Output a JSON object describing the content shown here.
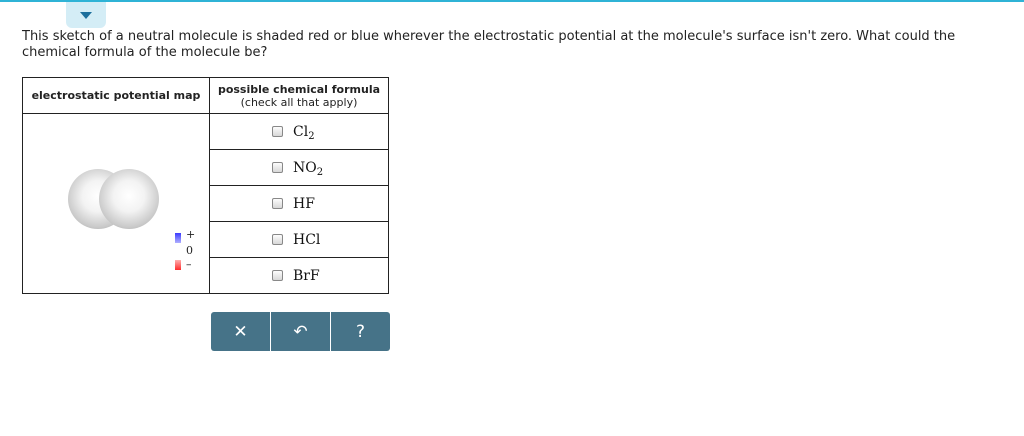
{
  "question": {
    "text": "This sketch of a neutral molecule is shaded red or blue wherever the electrostatic potential at the molecule's surface isn't zero. What could the chemical formula of the molecule be?"
  },
  "table": {
    "col1_header": "electrostatic potential map",
    "col2_header_line1": "possible chemical formula",
    "col2_header_line2": "(check all that apply)",
    "legend": {
      "plus": "+",
      "zero": "0",
      "minus": "–"
    },
    "options": [
      {
        "base": "Cl",
        "sub": "2",
        "checked": false
      },
      {
        "base": "NO",
        "sub": "2",
        "checked": false
      },
      {
        "base": "HF",
        "sub": "",
        "checked": false
      },
      {
        "base": "HCl",
        "sub": "",
        "checked": false
      },
      {
        "base": "BrF",
        "sub": "",
        "checked": false
      }
    ]
  },
  "buttons": {
    "clear": "✕",
    "undo": "↶",
    "help": "?"
  },
  "colors": {
    "accent": "#2fb3d6",
    "button_bar": "#467388",
    "legend_positive": "#3b3bff",
    "legend_negative": "#ff2b2b"
  }
}
